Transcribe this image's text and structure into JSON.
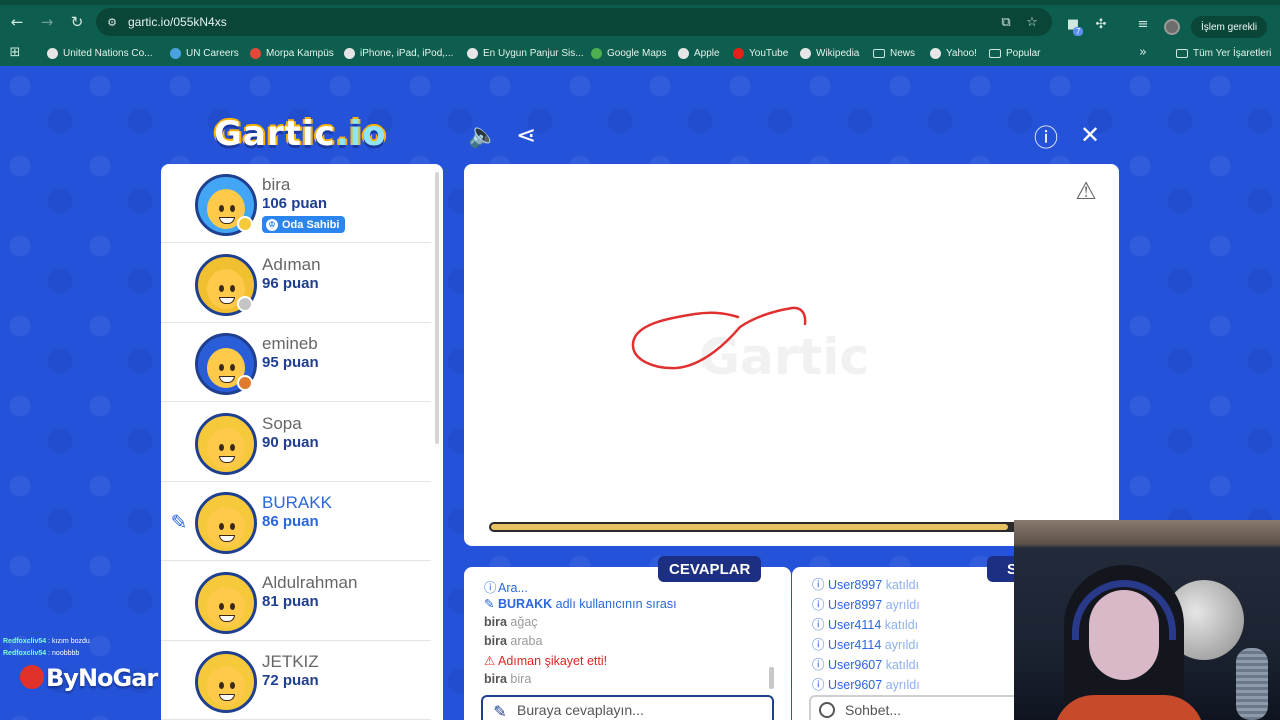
{
  "browser": {
    "url": "gartic.io/055kN4xs",
    "profile_action": "İşlem gerekli",
    "extension_badge": "7",
    "bookmarks": [
      {
        "label": "United Nations Co...",
        "icon": "globe-icon"
      },
      {
        "label": "UN Careers",
        "icon": "un-icon"
      },
      {
        "label": "Morpa Kampüs",
        "icon": "morpa-icon"
      },
      {
        "label": "iPhone, iPad, iPod,...",
        "icon": "globe-icon"
      },
      {
        "label": "En Uygun Panjur Sis...",
        "icon": "globe-icon"
      },
      {
        "label": "Google Maps",
        "icon": "maps-icon"
      },
      {
        "label": "Apple",
        "icon": "globe-icon"
      },
      {
        "label": "YouTube",
        "icon": "youtube-icon"
      },
      {
        "label": "Wikipedia",
        "icon": "globe-icon"
      },
      {
        "label": "News",
        "icon": "folder-icon"
      },
      {
        "label": "Yahoo!",
        "icon": "globe-icon"
      },
      {
        "label": "Popular",
        "icon": "folder-icon"
      }
    ],
    "all_bookmarks": "Tüm Yer İşaretleri"
  },
  "game": {
    "logo_main": "Gartic",
    "logo_suffix": ".io",
    "players": [
      {
        "name": "bira",
        "score": "106 puan",
        "status_color": "#f5c93a",
        "badge": "Oda Sahibi",
        "avatar_bg": "#42a5f5"
      },
      {
        "name": "Adıman",
        "score": "96 puan",
        "status_color": "#c4c4c4",
        "avatar_bg": "#f0c030"
      },
      {
        "name": "emineb",
        "score": "95 puan",
        "status_color": "#e07a2e",
        "avatar_bg": "#2a5ed8"
      },
      {
        "name": "Sopa",
        "score": "90 puan",
        "avatar_bg": "#f5c93a"
      },
      {
        "name": "BURAKK",
        "score": "86 puan",
        "drawing": true,
        "avatar_bg": "#f5c93a"
      },
      {
        "name": "Aldulrahman",
        "score": "81 puan",
        "avatar_bg": "#f5c93a"
      },
      {
        "name": "JETKIZ",
        "score": "72 puan",
        "avatar_bg": "#f5c93a"
      }
    ],
    "timer_fraction": 0.93,
    "answers_tab": "CEVAPLAR",
    "answers": [
      {
        "type": "info",
        "text": "Ara..."
      },
      {
        "type": "turn",
        "user": "BURAKK",
        "text": "adlı kullanıcının sırası"
      },
      {
        "type": "guess",
        "user": "bira",
        "text": "ağaç"
      },
      {
        "type": "guess",
        "user": "bira",
        "text": "araba"
      },
      {
        "type": "report",
        "user": "Adıman",
        "text": "şikayet etti!"
      },
      {
        "type": "guess",
        "user": "bira",
        "text": "bira"
      }
    ],
    "answer_placeholder": "Buraya cevaplayın...",
    "chat_tab": "S",
    "chat": [
      {
        "user": "User8997",
        "action": "katıldı"
      },
      {
        "user": "User8997",
        "action": "ayrıldı"
      },
      {
        "user": "User4114",
        "action": "katıldı"
      },
      {
        "user": "User4114",
        "action": "ayrıldı"
      },
      {
        "user": "User9607",
        "action": "katıldı"
      },
      {
        "user": "User9607",
        "action": "ayrıldı"
      }
    ],
    "chat_placeholder": "Sohbet..."
  },
  "overlay": {
    "stream_chat": [
      {
        "nick": "Redfoxcliv54",
        "msg": "kızım bozdu"
      },
      {
        "nick": "Redfoxcliv54",
        "msg": "noobbbb"
      }
    ],
    "watermark": "ByNoGar"
  },
  "colors": {
    "page_bg": "#2452d9",
    "chrome": "#0d5e4e",
    "stroke": "#e0302f",
    "accent": "#2a66e0",
    "dark_blue": "#1f3f8f"
  }
}
